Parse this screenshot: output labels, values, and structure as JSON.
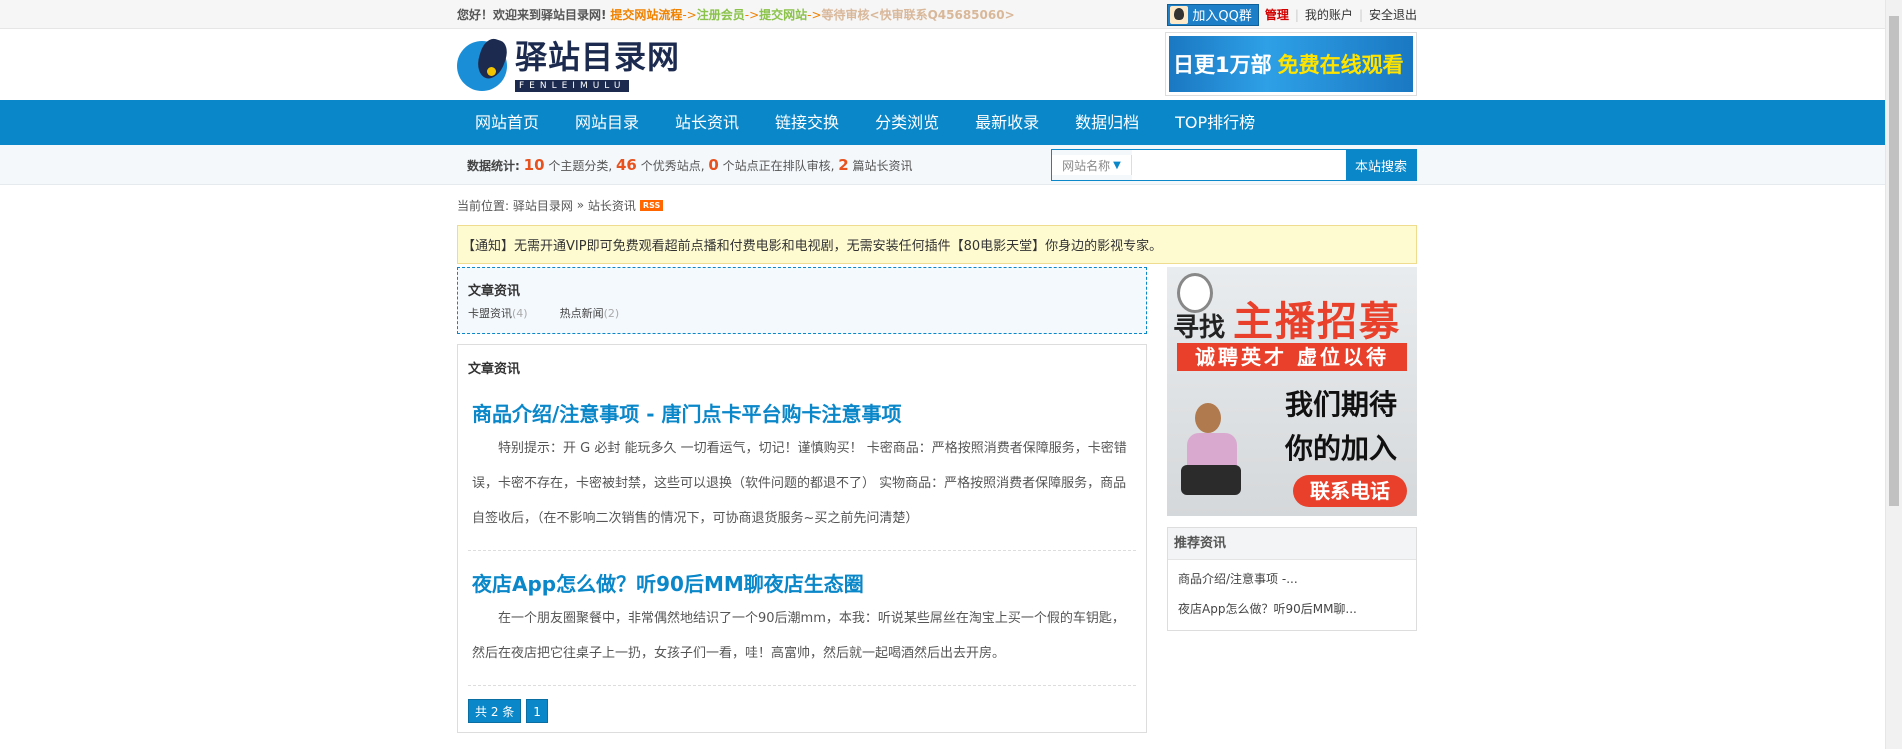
{
  "topbar": {
    "welcome": "您好！欢迎来到驿站目录网!",
    "steps": [
      "提交网站流程",
      "注册会员",
      "提交网站",
      "等待审核<快审联系Q45685060>"
    ],
    "arrow": "->",
    "qq_group": "加入QQ群",
    "manage": "管理",
    "my_account": "我的账户",
    "logout": "安全退出",
    "divider": "|"
  },
  "header": {
    "logo_title": "驿站目录网",
    "logo_sub": "FENLEIMULU",
    "ad_text_1": "日更1万部",
    "ad_text_2": "免费在线观看"
  },
  "nav": {
    "items": [
      "网站首页",
      "网站目录",
      "站长资讯",
      "链接交换",
      "分类浏览",
      "最新收录",
      "数据归档",
      "TOP排行榜"
    ]
  },
  "stats": {
    "label": "数据统计:",
    "categories": "10",
    "categories_text": "个主题分类,",
    "sites": "46",
    "sites_text": "个优秀站点,",
    "pending": "0",
    "pending_text": "个站点正在排队审核,",
    "articles": "2",
    "articles_text": "篇站长资讯"
  },
  "search": {
    "select_value": "网站名称",
    "placeholder": "",
    "button": "本站搜索"
  },
  "breadcrumb": {
    "prefix": "当前位置:",
    "home": "驿站目录网",
    "sep": "»",
    "current": "站长资讯",
    "rss": "RSS"
  },
  "notice": {
    "text": "【通知】无需开通VIP即可免费观看超前点播和付费电影和电视剧，无需安装任何插件【80电影天堂】你身边的影视专家。"
  },
  "categories_box": {
    "title": "文章资讯",
    "links": [
      {
        "label": "卡盟资讯",
        "count": "(4)"
      },
      {
        "label": "热点新闻",
        "count": "(2)"
      }
    ]
  },
  "article_list": {
    "title": "文章资讯",
    "articles": [
      {
        "title": "商品介绍/注意事项 - 唐门点卡平台购卡注意事项",
        "summary": "特别提示：开 G 必封 能玩多久 一切看运气，切记！谨慎购买！ 卡密商品：严格按照消费者保障服务，卡密错误，卡密不存在，卡密被封禁，这些可以退换（软件问题的都退不了） 实物商品：严格按照消费者保障服务，商品自签收后，（在不影响二次销售的情况下，可协商退货服务~买之前先问清楚）"
      },
      {
        "title": "夜店App怎么做？听90后MM聊夜店生态圈",
        "summary": "在一个朋友圈聚餐中，非常偶然地结识了一个90后潮mm，本我：听说某些屌丝在淘宝上买一个假的车钥匙，然后在夜店把它往桌子上一扔，女孩子们一看，哇！高富帅，然后就一起喝酒然后出去开房。"
      }
    ],
    "pager_total": "共 2 条",
    "pager_current": "1"
  },
  "banner": {
    "find": "寻找",
    "main": "主播招募",
    "sub": "诚聘英才 虚位以待",
    "wait": "我们期待",
    "join": "你的加入",
    "contact": "联系电话"
  },
  "recommend": {
    "title": "推荐资讯",
    "items": [
      "商品介绍/注意事项 -...",
      "夜店App怎么做？听90后MM聊..."
    ]
  }
}
